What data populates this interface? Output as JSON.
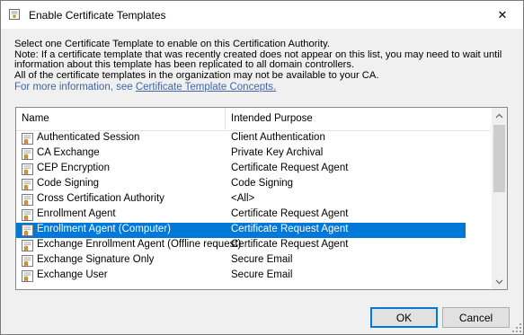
{
  "window": {
    "title": "Enable Certificate Templates",
    "close_glyph": "✕"
  },
  "description": {
    "line1": "Select one Certificate Template to enable on this Certification Authority.",
    "line2": "Note: If a certificate template that was recently created does not appear on this list, you may need to wait until",
    "line3": "information about this template has been replicated to all domain controllers.",
    "line4": "All of the certificate templates in the organization may not be available to your CA.",
    "link_prefix": "For more information, see ",
    "link_text": "Certificate Template Concepts.",
    "link_color": "#3f66a8"
  },
  "list": {
    "columns": {
      "name": "Name",
      "purpose": "Intended Purpose"
    },
    "rows": [
      {
        "name": "Authenticated Session",
        "purpose": "Client Authentication"
      },
      {
        "name": "CA Exchange",
        "purpose": "Private Key Archival"
      },
      {
        "name": "CEP Encryption",
        "purpose": "Certificate Request Agent"
      },
      {
        "name": "Code Signing",
        "purpose": "Code Signing"
      },
      {
        "name": "Cross Certification Authority",
        "purpose": "<All>"
      },
      {
        "name": "Enrollment Agent",
        "purpose": "Certificate Request Agent"
      },
      {
        "name": "Enrollment Agent (Computer)",
        "purpose": "Certificate Request Agent",
        "selected": true
      },
      {
        "name": "Exchange Enrollment Agent (Offline request)",
        "purpose": "Certificate Request Agent"
      },
      {
        "name": "Exchange Signature Only",
        "purpose": "Secure Email"
      },
      {
        "name": "Exchange User",
        "purpose": "Secure Email"
      }
    ],
    "row_icon": "certificate-template-icon",
    "selection_color": "#0078d7"
  },
  "buttons": {
    "ok": "OK",
    "cancel": "Cancel"
  }
}
